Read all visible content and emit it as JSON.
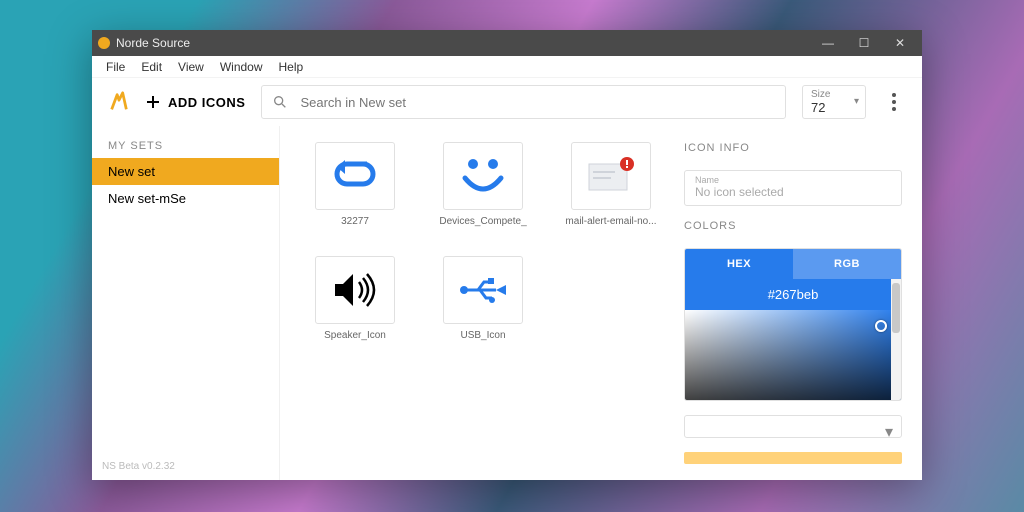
{
  "window": {
    "title": "Norde Source"
  },
  "menu": {
    "file": "File",
    "edit": "Edit",
    "view": "View",
    "window": "Window",
    "help": "Help"
  },
  "toolbar": {
    "add_icons": "ADD ICONS",
    "search_placeholder": "Search in New set",
    "size_label": "Size",
    "size_value": "72"
  },
  "sidebar": {
    "my_sets_label": "MY SETS",
    "items": [
      {
        "label": "New set",
        "active": true
      },
      {
        "label": "New set-mSe",
        "active": false
      }
    ],
    "footer": "NS Beta v0.2.32"
  },
  "icons": [
    {
      "name": "32277"
    },
    {
      "name": "Devices_Compete_"
    },
    {
      "name": "mail-alert-email-no..."
    },
    {
      "name": "Speaker_Icon"
    },
    {
      "name": "USB_Icon"
    }
  ],
  "info": {
    "heading": "ICON INFO",
    "name_label": "Name",
    "name_value": "No icon selected",
    "colors_heading": "COLORS",
    "tabs": {
      "hex": "HEX",
      "rgb": "RGB"
    },
    "hex_value": "#267beb"
  },
  "colors": {
    "accent": "#f0a91f",
    "blue": "#267beb"
  }
}
